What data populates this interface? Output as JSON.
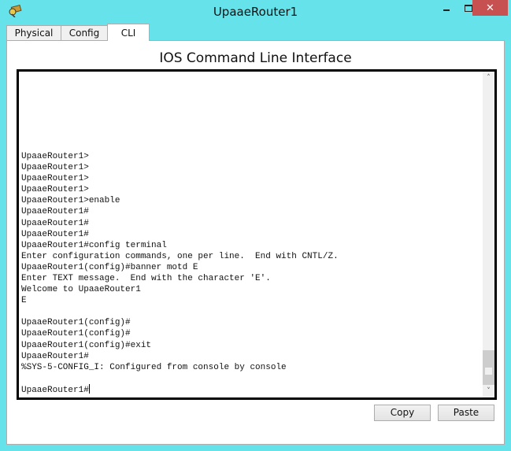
{
  "window": {
    "title": "UpaaeRouter1",
    "icon": "router-app-icon",
    "controls": {
      "minimize": "minimize-icon",
      "maximize": "maximize-icon",
      "close": "✕"
    }
  },
  "tabs": [
    {
      "label": "Physical",
      "active": false
    },
    {
      "label": "Config",
      "active": false
    },
    {
      "label": "CLI",
      "active": true
    }
  ],
  "cli": {
    "heading": "IOS Command Line Interface",
    "lines": [
      "UpaaeRouter1>",
      "UpaaeRouter1>",
      "UpaaeRouter1>",
      "UpaaeRouter1>",
      "UpaaeRouter1>enable",
      "UpaaeRouter1#",
      "UpaaeRouter1#",
      "UpaaeRouter1#",
      "UpaaeRouter1#config terminal",
      "Enter configuration commands, one per line.  End with CNTL/Z.",
      "UpaaeRouter1(config)#banner motd E",
      "Enter TEXT message.  End with the character 'E'.",
      "Welcome to UpaaeRouter1",
      "E",
      "",
      "UpaaeRouter1(config)#",
      "UpaaeRouter1(config)#",
      "UpaaeRouter1(config)#exit",
      "UpaaeRouter1#",
      "%SYS-5-CONFIG_I: Configured from console by console",
      ""
    ],
    "prompt": "UpaaeRouter1#",
    "scroll_position": 0.97
  },
  "buttons": {
    "copy": "Copy",
    "paste": "Paste"
  }
}
